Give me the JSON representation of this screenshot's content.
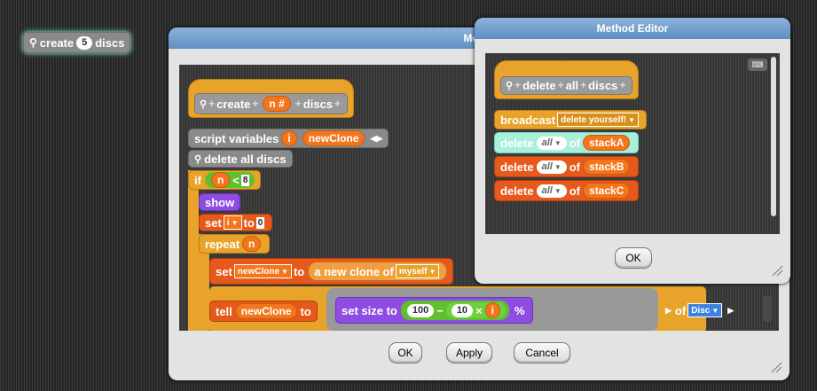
{
  "palette_block": {
    "label_pre": "create",
    "count": "5",
    "label_post": "discs"
  },
  "main_dialog": {
    "title": "Metho",
    "hat": {
      "w1": "create",
      "param": "n #",
      "w2": "discs"
    },
    "script_vars": {
      "label": "script variables",
      "v1": "i",
      "v2": "newClone"
    },
    "delete_all": "delete all discs",
    "if_block": {
      "kw": "if",
      "var": "n",
      "op": "<",
      "num": "8"
    },
    "show": "show",
    "set1": {
      "kw": "set",
      "var": "i",
      "to": "to",
      "val": "0"
    },
    "repeat": {
      "kw": "repeat",
      "var": "n"
    },
    "set2": {
      "kw": "set",
      "var": "newClone",
      "to": "to",
      "rep": "a new clone of",
      "obj": "myself"
    },
    "tell": {
      "kw": "tell",
      "var": "newClone",
      "to": "to",
      "cmd": "set size to",
      "n1": "100",
      "minus": "−",
      "n2": "10",
      "times": "×",
      "v": "i",
      "pct": "%",
      "of": "of",
      "obj": "Disc"
    },
    "buttons": {
      "ok": "OK",
      "apply": "Apply",
      "cancel": "Cancel"
    }
  },
  "method_editor": {
    "title": "Method Editor",
    "hat": {
      "w1": "delete",
      "w2": "all",
      "w3": "discs"
    },
    "broadcast": {
      "kw": "broadcast",
      "msg": "delete yourself!"
    },
    "rows": [
      {
        "kw": "delete",
        "sel": "all",
        "of": "of",
        "list": "stackA"
      },
      {
        "kw": "delete",
        "sel": "all",
        "of": "of",
        "list": "stackB"
      },
      {
        "kw": "delete",
        "sel": "all",
        "of": "of",
        "list": "stackC"
      }
    ],
    "ok": "OK"
  }
}
